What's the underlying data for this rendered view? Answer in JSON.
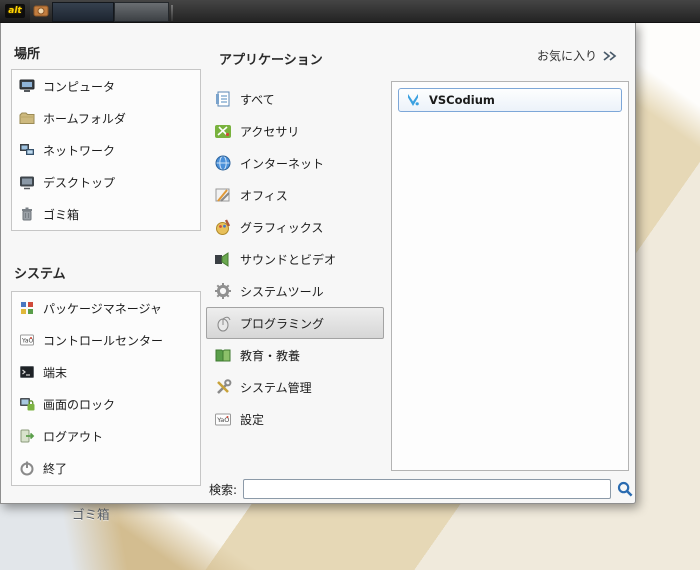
{
  "panel": {
    "menu_button_label": "alt"
  },
  "menu": {
    "places": {
      "header": "場所",
      "items": [
        {
          "label": "コンピュータ",
          "icon": "computer-icon"
        },
        {
          "label": "ホームフォルダ",
          "icon": "home-folder-icon"
        },
        {
          "label": "ネットワーク",
          "icon": "network-icon"
        },
        {
          "label": "デスクトップ",
          "icon": "desktop-icon"
        },
        {
          "label": "ゴミ箱",
          "icon": "trash-icon"
        }
      ]
    },
    "system": {
      "header": "システム",
      "items": [
        {
          "label": "パッケージマネージャ",
          "icon": "package-manager-icon"
        },
        {
          "label": "コントロールセンター",
          "icon": "control-center-icon"
        },
        {
          "label": "端末",
          "icon": "terminal-icon"
        },
        {
          "label": "画面のロック",
          "icon": "lock-screen-icon"
        },
        {
          "label": "ログアウト",
          "icon": "logout-icon"
        },
        {
          "label": "終了",
          "icon": "quit-icon"
        }
      ]
    },
    "applications": {
      "header": "アプリケーション",
      "favorites_label": "お気に入り",
      "categories": [
        {
          "label": "すべて",
          "icon": "all-apps-icon"
        },
        {
          "label": "アクセサリ",
          "icon": "accessories-icon"
        },
        {
          "label": "インターネット",
          "icon": "internet-icon"
        },
        {
          "label": "オフィス",
          "icon": "office-icon"
        },
        {
          "label": "グラフィックス",
          "icon": "graphics-icon"
        },
        {
          "label": "サウンドとビデオ",
          "icon": "sound-video-icon"
        },
        {
          "label": "システムツール",
          "icon": "system-tools-icon"
        },
        {
          "label": "プログラミング",
          "icon": "programming-icon",
          "selected": true
        },
        {
          "label": "教育・教養",
          "icon": "education-icon"
        },
        {
          "label": "システム管理",
          "icon": "system-admin-icon"
        },
        {
          "label": "設定",
          "icon": "settings-icon"
        }
      ],
      "apps": [
        {
          "label": "VSCodium",
          "icon": "vscodium-icon",
          "selected": true
        }
      ]
    },
    "search": {
      "label": "検索:",
      "value": ""
    }
  },
  "desktop": {
    "trash_label": "ゴミ箱"
  },
  "colors": {
    "selection_border": "#7da7d8",
    "accent_blue": "#2a6bb0",
    "panel_bg": "#2b2b2b",
    "menu_bg": "#f7f7f7"
  }
}
